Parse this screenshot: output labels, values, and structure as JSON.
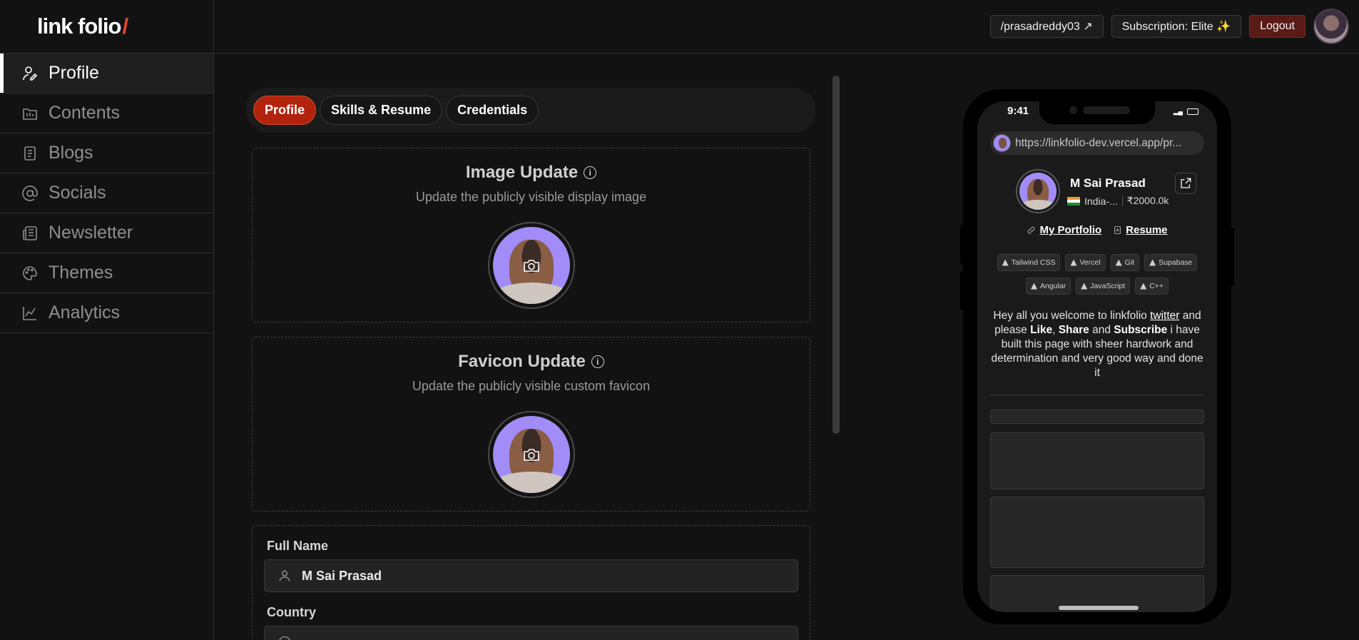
{
  "app": {
    "logo_text": "link folio",
    "logo_slash": "/",
    "accent": "#e8452c"
  },
  "sidebar": {
    "items": [
      {
        "label": "Profile",
        "icon": "user-edit-icon",
        "active": true
      },
      {
        "label": "Contents",
        "icon": "folder-icon",
        "active": false
      },
      {
        "label": "Blogs",
        "icon": "book-icon",
        "active": false
      },
      {
        "label": "Socials",
        "icon": "at-sign-icon",
        "active": false
      },
      {
        "label": "Newsletter",
        "icon": "newspaper-icon",
        "active": false
      },
      {
        "label": "Themes",
        "icon": "palette-icon",
        "active": false
      },
      {
        "label": "Analytics",
        "icon": "chart-line-icon",
        "active": false
      }
    ]
  },
  "topbar": {
    "handle": "/prasadreddy03 ↗",
    "subscription": "Subscription: Elite ✨",
    "logout": "Logout"
  },
  "tabs": [
    {
      "label": "Profile",
      "active": true
    },
    {
      "label": "Skills & Resume",
      "active": false
    },
    {
      "label": "Credentials",
      "active": false
    }
  ],
  "image_update": {
    "title": "Image Update",
    "subtitle": "Update the publicly visible display image"
  },
  "favicon_update": {
    "title": "Favicon Update",
    "subtitle": "Update the publicly visible custom favicon"
  },
  "form": {
    "full_name_label": "Full Name",
    "full_name_value": "M Sai Prasad",
    "country_label": "Country"
  },
  "preview": {
    "time": "9:41",
    "url": "https://linkfolio-dev.vercel.app/pr...",
    "name": "M Sai Prasad",
    "country": "India-...",
    "amount": "₹2000.0k",
    "links": [
      {
        "label": "My Portfolio",
        "icon": "link-icon"
      },
      {
        "label": "Resume",
        "icon": "file-icon"
      }
    ],
    "skills": [
      "Tailwind CSS",
      "Vercel",
      "Git",
      "Supabase",
      "Angular",
      "JavaScript",
      "C++"
    ],
    "bio": {
      "p1": "Hey all you welcome to linkfolio ",
      "twitter": "twitter",
      "p2": " and please ",
      "like": "Like",
      "comma": ", ",
      "share": "Share",
      "and": " and ",
      "subscribe": "Subscribe",
      "p3": " i have built this page with sheer hardwork and determination and very good way and done it"
    }
  }
}
